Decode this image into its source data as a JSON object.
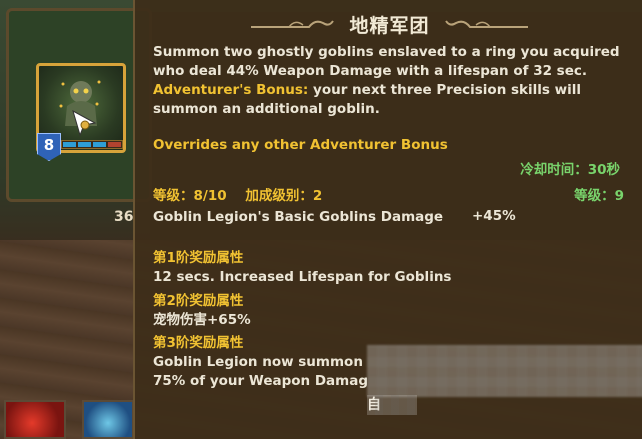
{
  "skill": {
    "title": "地精军团",
    "level_badge": "8",
    "progress": {
      "filled_segments": 3,
      "total_segments": 4
    },
    "description": "Summon two ghostly goblins enslaved to a ring you acquired who deal 44% Weapon Damage  with a lifespan of 32 sec.",
    "adventurer_bonus_label": "Adventurer's Bonus:",
    "adventurer_bonus_text": " your next three Precision skills will summon an additional goblin.",
    "overrides_text": "Overrides any other Adventurer Bonus",
    "cooldown_label": "冷却时间：",
    "cooldown_value": "30秒",
    "level_label": "等级：",
    "level_value": "8/10",
    "boost_label": "加成级别：",
    "boost_value": "2",
    "required_level_label": "等级：",
    "required_level_value": "9",
    "basic_line": "Goblin Legion's Basic Goblins Damage",
    "basic_value": "+45%",
    "tiers": [
      {
        "head": "第1阶奖励属性",
        "text": "12 secs. Increased Lifespan for Goblins"
      },
      {
        "head": "第2阶奖励属性",
        "text": "宠物伤害+65%"
      },
      {
        "head": "第3阶奖励属性",
        "text_line1": "Goblin Legion now summon",
        "text_line2": "75% of your Weapon Damag"
      }
    ],
    "bottom_fragment": "自"
  },
  "background": {
    "side_number": "36"
  }
}
